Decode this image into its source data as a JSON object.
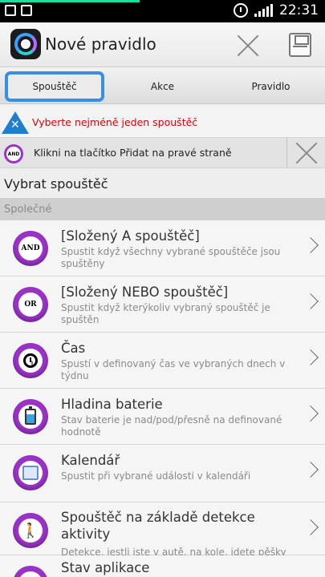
{
  "status_bar": {
    "time": "22:31",
    "progress_percent": 43
  },
  "action_bar": {
    "title": "Nové pravidlo"
  },
  "tabs": [
    {
      "label": "Spouštěč",
      "selected": true
    },
    {
      "label": "Akce",
      "selected": false
    },
    {
      "label": "Pravidlo",
      "selected": false
    }
  ],
  "warning": {
    "text": "Vyberte nejméně jeden spouštěč"
  },
  "info": {
    "badge": "AND",
    "text": "Klikni na tlačítko Přidat na pravé straně"
  },
  "section": {
    "title": "Vybrat spouštěč",
    "group": "Společné"
  },
  "triggers": [
    {
      "icon": "and-badge",
      "badge_text": "AND",
      "title": "[Složený A spouštěč]",
      "description": "Spustit když všechny vybrané spouštěče jsou spuštěny"
    },
    {
      "icon": "or-badge",
      "badge_text": "OR",
      "title": "[Složený NEBO spouštěč]",
      "description": "Spustit když kterýkoliv vybraný spouštěč je spuštěn"
    },
    {
      "icon": "clock-icon",
      "title": "Čas",
      "description": "Spustí v definovaný čas ve vybraných dnech v týdnu"
    },
    {
      "icon": "battery-icon",
      "title": "Hladina baterie",
      "description": "Stav baterie je nad/pod/přesně na definované hodnotě"
    },
    {
      "icon": "calendar-icon",
      "title": "Kalendář",
      "description": "Spustit při vybrané události v kalendáři"
    },
    {
      "icon": "walking-person-icon",
      "title": "Spouštěč na základě detekce aktivity",
      "description": "Detekce, jestli jste v autě, na kole, jdete pěšky"
    },
    {
      "icon": "app-icon",
      "title": "Stav aplikace"
    }
  ],
  "colors": {
    "accent": "#9a32c8",
    "tab_highlight": "#3a8ee0",
    "warning_text": "#e00000",
    "warning_icon": "#1e7fd0"
  }
}
